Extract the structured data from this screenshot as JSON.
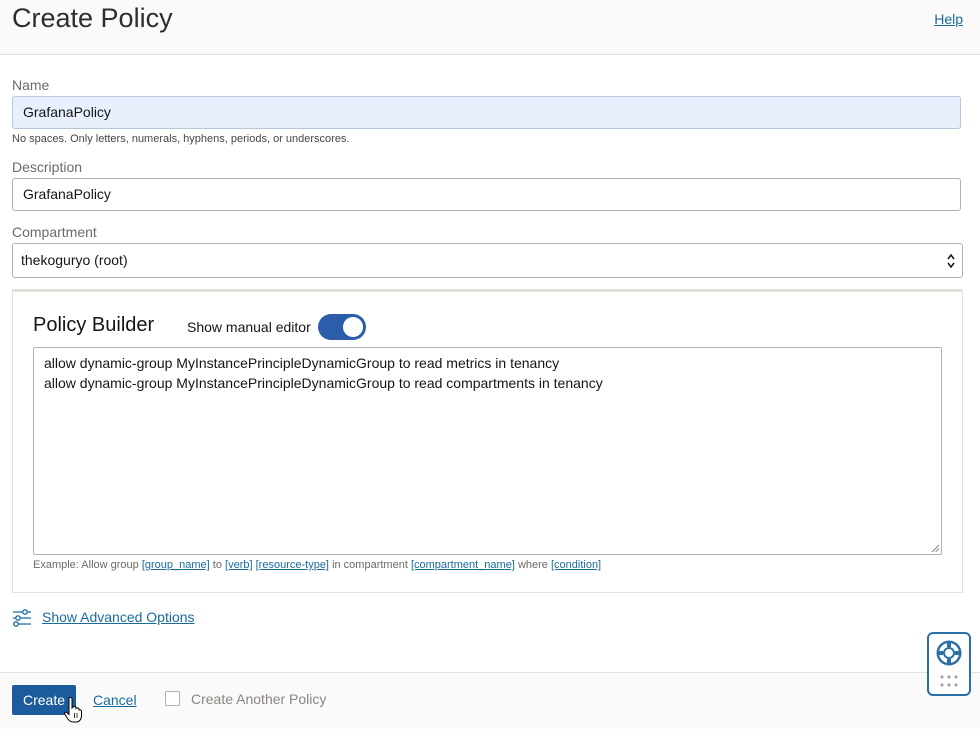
{
  "header": {
    "title": "Create Policy",
    "help_label": "Help"
  },
  "form": {
    "name_label": "Name",
    "name_value": "GrafanaPolicy",
    "name_hint": "No spaces. Only letters, numerals, hyphens, periods, or underscores.",
    "description_label": "Description",
    "description_value": "GrafanaPolicy",
    "compartment_label": "Compartment",
    "compartment_value": "thekoguryo (root)"
  },
  "policy_builder": {
    "title": "Policy Builder",
    "toggle_label": "Show manual editor",
    "toggle_on": true,
    "statements": [
      "allow dynamic-group MyInstancePrincipleDynamicGroup to read metrics in tenancy",
      "allow dynamic-group MyInstancePrincipleDynamicGroup to read compartments in tenancy"
    ],
    "example": {
      "prefix": "Example: Allow group",
      "group_name": "[group_name]",
      "to": "to",
      "verb": "[verb]",
      "resource_type": "[resource-type]",
      "in_compartment": "in compartment",
      "compartment_name": "[compartment_name]",
      "where": "where",
      "condition": "[condition]"
    }
  },
  "advanced": {
    "label": "Show Advanced Options",
    "icon": "sliders-icon"
  },
  "footer": {
    "create_label": "Create",
    "cancel_label": "Cancel",
    "create_another_label": "Create Another Policy",
    "create_another_checked": false
  },
  "helper_widget": {
    "icon": "lifebuoy-icon"
  },
  "colors": {
    "primary": "#1c5c9c",
    "link": "#1a6c9c",
    "toggle": "#2c5dab",
    "focus_bg": "#e8f0fe"
  }
}
